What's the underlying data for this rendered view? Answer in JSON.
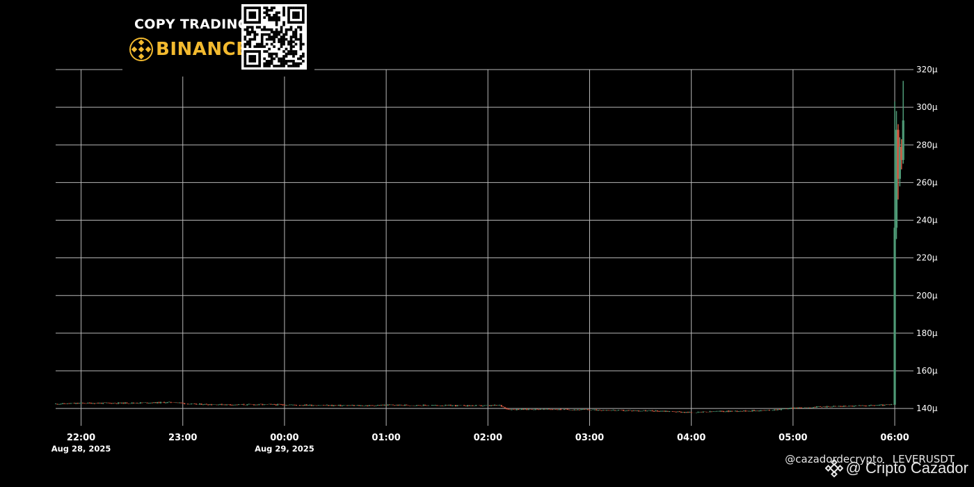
{
  "banner": {
    "title": "COPY TRADING",
    "brand": "BINANCE",
    "brand_color": "#f3ba2f",
    "logo_icon": "binance-logo-icon",
    "qr_icon": "qr-code-icon"
  },
  "footer": {
    "handle": "@cazadordecrypto",
    "symbol": "LEVERUSDT",
    "watermark": "@ Cripto Cazador",
    "watermark_icon": "binance-diamond-icon"
  },
  "colors": {
    "background": "#000000",
    "grid": "#b8b8b8",
    "up": "#4e9a76",
    "down": "#d4563f",
    "text": "#ffffff"
  },
  "chart_data": {
    "type": "candlestick",
    "title": "",
    "xlabel": "",
    "ylabel": "",
    "y_unit": "μ",
    "ylim": [
      136,
      320
    ],
    "y_ticks": [
      140,
      160,
      180,
      200,
      220,
      240,
      260,
      280,
      300,
      320
    ],
    "y_tick_labels": [
      "140μ",
      "160μ",
      "180μ",
      "200μ",
      "220μ",
      "240μ",
      "260μ",
      "280μ",
      "300μ",
      "320μ"
    ],
    "xlim": [
      "2025-08-28 21:45",
      "2025-08-29 06:09"
    ],
    "x_ticks": [
      {
        "time": "2025-08-28 22:00",
        "label": "22:00",
        "date_label": "Aug 28, 2025"
      },
      {
        "time": "2025-08-28 23:00",
        "label": "23:00",
        "date_label": ""
      },
      {
        "time": "2025-08-29 00:00",
        "label": "00:00",
        "date_label": "Aug 29, 2025"
      },
      {
        "time": "2025-08-29 01:00",
        "label": "01:00",
        "date_label": ""
      },
      {
        "time": "2025-08-29 02:00",
        "label": "02:00",
        "date_label": ""
      },
      {
        "time": "2025-08-29 03:00",
        "label": "03:00",
        "date_label": ""
      },
      {
        "time": "2025-08-29 04:00",
        "label": "04:00",
        "date_label": ""
      },
      {
        "time": "2025-08-29 05:00",
        "label": "05:00",
        "date_label": ""
      },
      {
        "time": "2025-08-29 06:00",
        "label": "06:00",
        "date_label": ""
      }
    ],
    "grid": true,
    "price_path": [
      [
        "2025-08-28 21:45",
        142.4
      ],
      [
        "2025-08-28 22:00",
        142.8
      ],
      [
        "2025-08-28 22:30",
        142.9
      ],
      [
        "2025-08-28 22:55",
        143.3
      ],
      [
        "2025-08-28 23:05",
        142.3
      ],
      [
        "2025-08-28 23:30",
        142.0
      ],
      [
        "2025-08-28 23:50",
        142.1
      ],
      [
        "2025-08-29 00:10",
        141.8
      ],
      [
        "2025-08-29 00:30",
        141.6
      ],
      [
        "2025-08-29 00:50",
        141.5
      ],
      [
        "2025-08-29 01:00",
        141.8
      ],
      [
        "2025-08-29 01:30",
        141.6
      ],
      [
        "2025-08-29 01:59",
        141.5
      ],
      [
        "2025-08-29 02:07",
        141.7
      ],
      [
        "2025-08-29 02:12",
        139.5
      ],
      [
        "2025-08-29 02:30",
        139.6
      ],
      [
        "2025-08-29 02:50",
        139.4
      ],
      [
        "2025-08-29 03:00",
        139.3
      ],
      [
        "2025-08-29 03:20",
        138.9
      ],
      [
        "2025-08-29 03:45",
        138.6
      ],
      [
        "2025-08-29 04:00",
        137.8
      ],
      [
        "2025-08-29 04:15",
        138.4
      ],
      [
        "2025-08-29 04:30",
        138.7
      ],
      [
        "2025-08-29 04:45",
        139.0
      ],
      [
        "2025-08-29 05:00",
        140.2
      ],
      [
        "2025-08-29 05:20",
        141.0
      ],
      [
        "2025-08-29 05:40",
        141.4
      ],
      [
        "2025-08-29 05:59",
        142.0
      ]
    ],
    "spike_candles": [
      {
        "time": "2025-08-29 06:00",
        "open": 142,
        "high": 303,
        "low": 142,
        "close": 236
      },
      {
        "time": "2025-08-29 06:01",
        "open": 236,
        "high": 298,
        "low": 230,
        "close": 288
      },
      {
        "time": "2025-08-29 06:02",
        "open": 288,
        "high": 291,
        "low": 251,
        "close": 262
      },
      {
        "time": "2025-08-29 06:03",
        "open": 262,
        "high": 284,
        "low": 258,
        "close": 279
      },
      {
        "time": "2025-08-29 06:04",
        "open": 279,
        "high": 283,
        "low": 267,
        "close": 272
      },
      {
        "time": "2025-08-29 06:05",
        "open": 272,
        "high": 314,
        "low": 270,
        "close": 293
      }
    ]
  }
}
